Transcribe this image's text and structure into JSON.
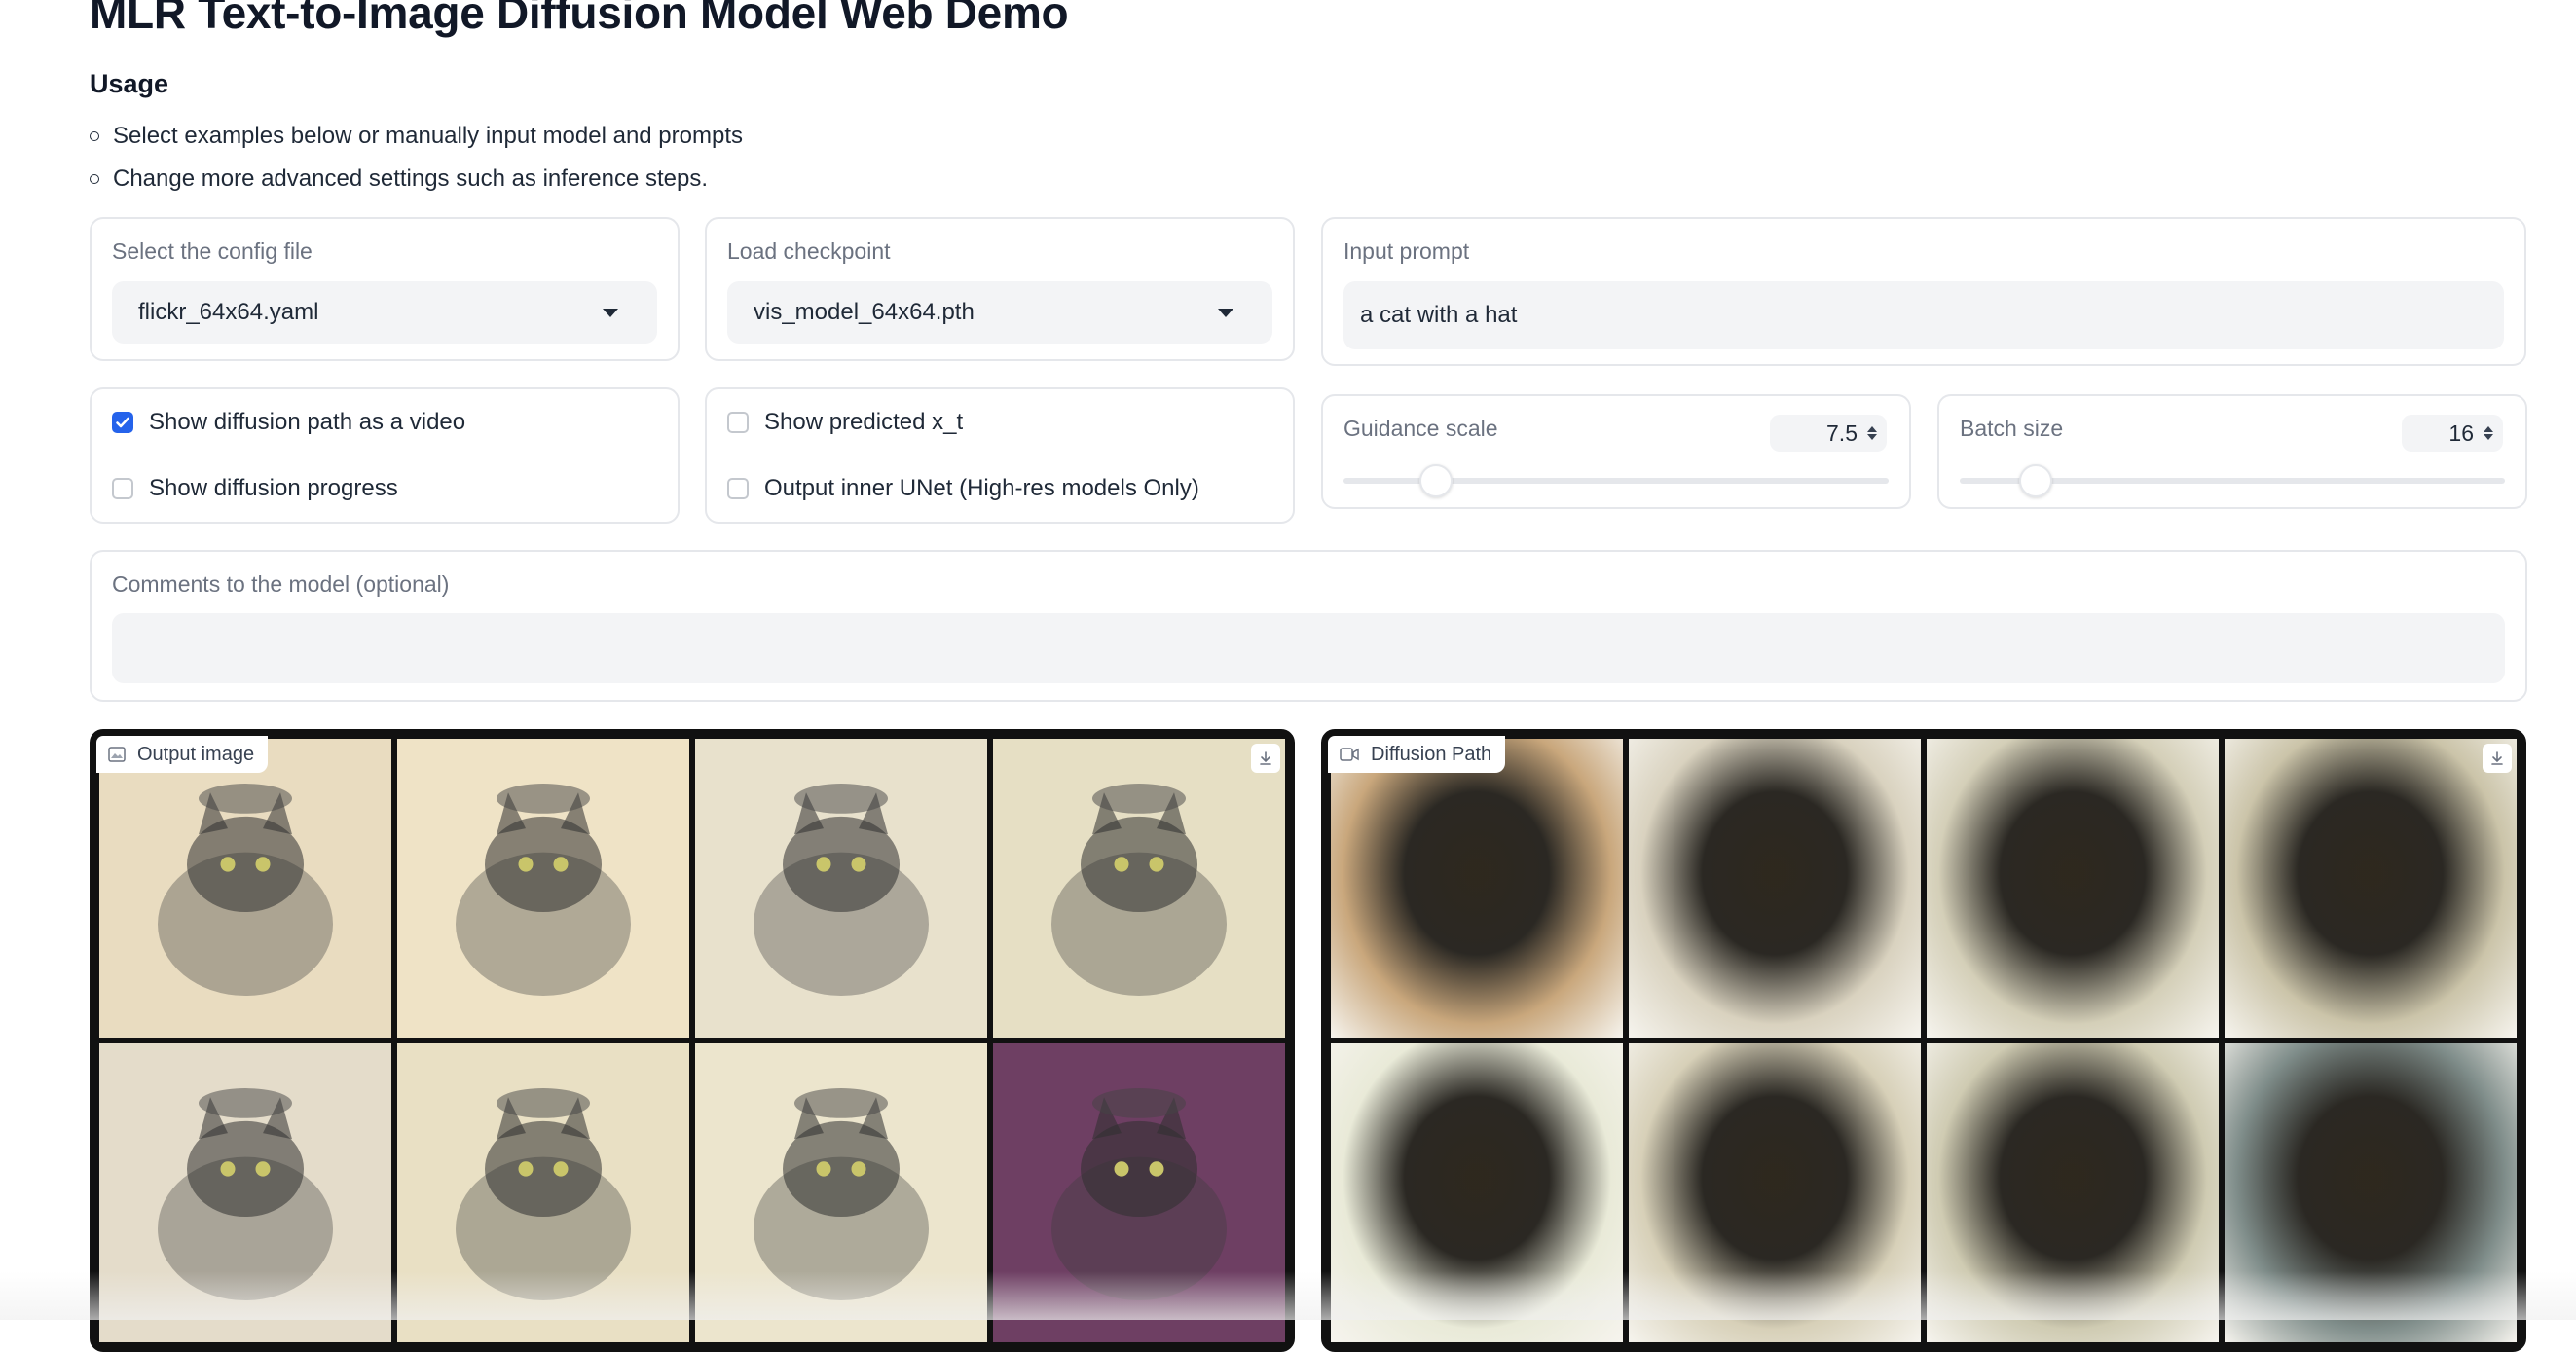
{
  "page": {
    "title": "MLR Text-to-Image Diffusion Model Web Demo",
    "usage_heading": "Usage",
    "usage_items": [
      "Select examples below or manually input model and prompts",
      "Change more advanced settings such as inference steps."
    ]
  },
  "config": {
    "label": "Select the config file",
    "value": "flickr_64x64.yaml"
  },
  "checkpoint": {
    "label": "Load checkpoint",
    "value": "vis_model_64x64.pth"
  },
  "prompt": {
    "label": "Input prompt",
    "value": "a cat with a hat"
  },
  "options_left": [
    {
      "label": "Show diffusion path as a video",
      "checked": true
    },
    {
      "label": "Show diffusion progress",
      "checked": false
    }
  ],
  "options_right": [
    {
      "label": "Show predicted x_t",
      "checked": false
    },
    {
      "label": "Output inner UNet (High-res models Only)",
      "checked": false
    }
  ],
  "guidance": {
    "label": "Guidance scale",
    "value": "7.5",
    "level": 0.17
  },
  "batch": {
    "label": "Batch size",
    "value": "16",
    "level": 0.14
  },
  "comments": {
    "label": "Comments to the model (optional)",
    "value": ""
  },
  "output_image": {
    "label": "Output image",
    "icon": "image-icon",
    "tiles": [
      "#e9dcc0",
      "#efe3c6",
      "#e8e1cc",
      "#e6dfc4",
      "#e4dcca",
      "#e9e0c4",
      "#ece5cd",
      "#6e3f63"
    ]
  },
  "diffusion_path": {
    "label": "Diffusion Path",
    "icon": "video-icon",
    "tiles": [
      "#c9a77c",
      "#d9d2bf",
      "#d4cfb8",
      "#cbc4a9",
      "#e9ead8",
      "#d7d0b8",
      "#cfcbb2",
      "#7f8d8a"
    ]
  },
  "colors": {
    "accent": "#2563eb",
    "border": "#e5e7eb",
    "field": "#f3f4f6"
  }
}
